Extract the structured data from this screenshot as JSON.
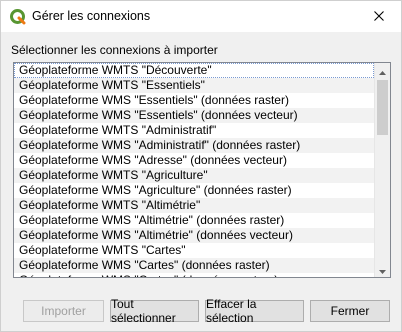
{
  "window": {
    "title": "Gérer les connexions",
    "app_icon": "qgis-icon",
    "close_icon": "close-icon"
  },
  "section_label": "Sélectionner les connexions à importer",
  "connections": [
    "Géoplateforme WMTS \"Découverte\"",
    "Géoplateforme WMTS \"Essentiels\"",
    "Géoplateforme WMS \"Essentiels\" (données raster)",
    "Géoplateforme WMS \"Essentiels\" (données vecteur)",
    "Géoplateforme WMTS \"Administratif\"",
    "Géoplateforme WMS \"Administratif\" (données raster)",
    "Géoplateforme WMS \"Adresse\" (données vecteur)",
    "Géoplateforme WMTS \"Agriculture\"",
    "Géoplateforme WMS \"Agriculture\" (données raster)",
    "Géoplateforme WMTS \"Altimétrie\"",
    "Géoplateforme WMS \"Altimétrie\" (données raster)",
    "Géoplateforme WMS \"Altimétrie\" (données vecteur)",
    "Géoplateforme WMTS \"Cartes\"",
    "Géoplateforme WMS \"Cartes\" (données raster)",
    "Géoplateforme WMS \"Cartes\" (données vecteur)"
  ],
  "buttons": {
    "import": "Importer",
    "select_all": "Tout sélectionner",
    "clear_selection": "Effacer la sélection",
    "close": "Fermer"
  }
}
